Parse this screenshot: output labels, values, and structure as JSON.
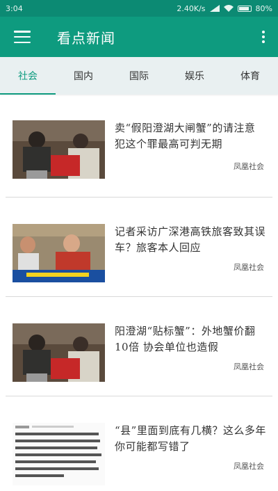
{
  "status_bar": {
    "time": "3:04",
    "speed": "2.40K/s",
    "battery": "80%"
  },
  "app_bar": {
    "title": "看点新闻"
  },
  "tabs": [
    {
      "label": "社会",
      "active": true
    },
    {
      "label": "国内",
      "active": false
    },
    {
      "label": "国际",
      "active": false
    },
    {
      "label": "娱乐",
      "active": false
    },
    {
      "label": "体育",
      "active": false
    }
  ],
  "articles": [
    {
      "title": "卖“假阳澄湖大闸蟹”的请注意 犯这个罪最高可判无期",
      "source": "凤凰社会"
    },
    {
      "title": "记者采访广深港高铁旅客致其误车？旅客本人回应",
      "source": "凤凰社会"
    },
    {
      "title": "阳澄湖“贴标蟹”：外地蟹价翻10倍 协会单位也造假",
      "source": "凤凰社会"
    },
    {
      "title": "“县”里面到底有几横？这么多年你可能都写错了",
      "source": "凤凰社会"
    }
  ],
  "colors": {
    "primary": "#0e9b7f",
    "status": "#0c8a73"
  }
}
